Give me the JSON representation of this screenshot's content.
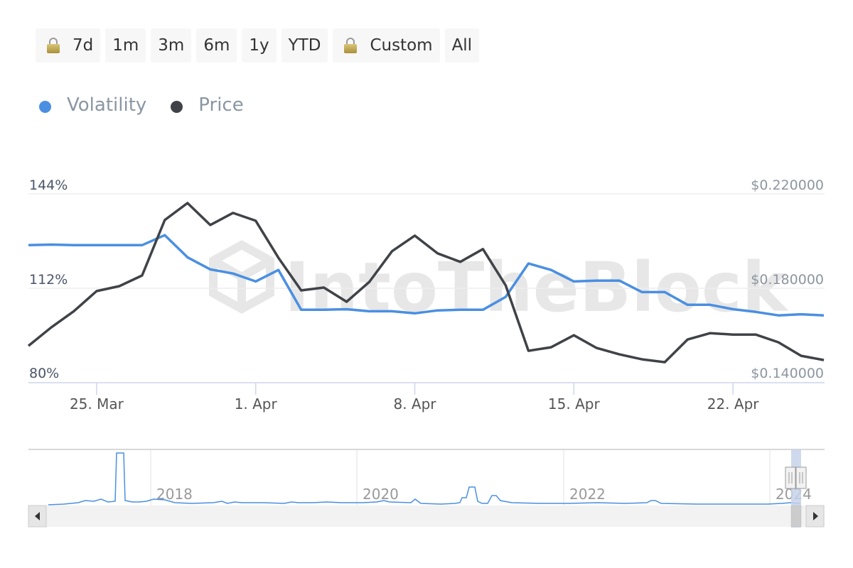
{
  "range_selector": {
    "buttons": [
      {
        "label": "7d",
        "locked": true
      },
      {
        "label": "1m",
        "locked": false
      },
      {
        "label": "3m",
        "locked": false
      },
      {
        "label": "6m",
        "locked": false
      },
      {
        "label": "1y",
        "locked": false
      },
      {
        "label": "YTD",
        "locked": false
      },
      {
        "label": "Custom",
        "locked": true
      },
      {
        "label": "All",
        "locked": false
      }
    ]
  },
  "legend": {
    "items": [
      {
        "label": "Volatility",
        "color": "#4a8fe2"
      },
      {
        "label": "Price",
        "color": "#3f4347"
      }
    ]
  },
  "watermark": "IntoTheBlock",
  "chart_data": {
    "type": "line",
    "title": "",
    "x": [
      "22 Mar",
      "23 Mar",
      "24 Mar",
      "25 Mar",
      "26 Mar",
      "27 Mar",
      "28 Mar",
      "29 Mar",
      "30 Mar",
      "31 Mar",
      "1 Apr",
      "2 Apr",
      "3 Apr",
      "4 Apr",
      "5 Apr",
      "6 Apr",
      "7 Apr",
      "8 Apr",
      "9 Apr",
      "10 Apr",
      "11 Apr",
      "12 Apr",
      "13 Apr",
      "14 Apr",
      "15 Apr",
      "16 Apr",
      "17 Apr",
      "18 Apr",
      "19 Apr",
      "20 Apr",
      "21 Apr",
      "22 Apr",
      "23 Apr",
      "24 Apr",
      "25 Apr",
      "26 Apr"
    ],
    "x_ticks": [
      "25. Mar",
      "1. Apr",
      "8. Apr",
      "15. Apr",
      "22. Apr"
    ],
    "x_tick_index": [
      3,
      10,
      17,
      24,
      31
    ],
    "series": [
      {
        "name": "Volatility",
        "axis": "left",
        "color": "#4a8fe2",
        "values": [
          126.6,
          126.8,
          126.6,
          126.6,
          126.6,
          126.6,
          130.0,
          122.5,
          118.4,
          117.0,
          114.3,
          118.2,
          104.7,
          104.7,
          104.9,
          104.2,
          104.2,
          103.5,
          104.5,
          104.7,
          104.7,
          109.1,
          120.4,
          118.2,
          114.3,
          114.6,
          114.6,
          110.7,
          110.7,
          106.4,
          106.4,
          104.9,
          104.0,
          102.8,
          103.2,
          102.8
        ]
      },
      {
        "name": "Price",
        "axis": "right",
        "color": "#3f4347",
        "values": [
          0.1556,
          0.1634,
          0.1703,
          0.1788,
          0.1809,
          0.1854,
          0.2089,
          0.2161,
          0.2068,
          0.2119,
          0.2086,
          0.1929,
          0.1791,
          0.1803,
          0.1743,
          0.1827,
          0.1957,
          0.2023,
          0.1948,
          0.1912,
          0.1966,
          0.1812,
          0.1535,
          0.155,
          0.1601,
          0.1547,
          0.152,
          0.1499,
          0.1487,
          0.1583,
          0.161,
          0.1604,
          0.1604,
          0.1571,
          0.1514,
          0.1496
        ]
      }
    ],
    "y_left": {
      "ticks": [
        "144%",
        "112%",
        "80%"
      ],
      "range": [
        80,
        144
      ]
    },
    "y_right": {
      "ticks": [
        "$0.220000",
        "$0.180000",
        "$0.140000"
      ],
      "range": [
        0.14,
        0.22
      ]
    },
    "grid": true,
    "legend_position": "top-left",
    "navigator": {
      "year_labels": [
        "2018",
        "2020",
        "2022",
        "2024"
      ],
      "series_name": "Volatility"
    }
  }
}
